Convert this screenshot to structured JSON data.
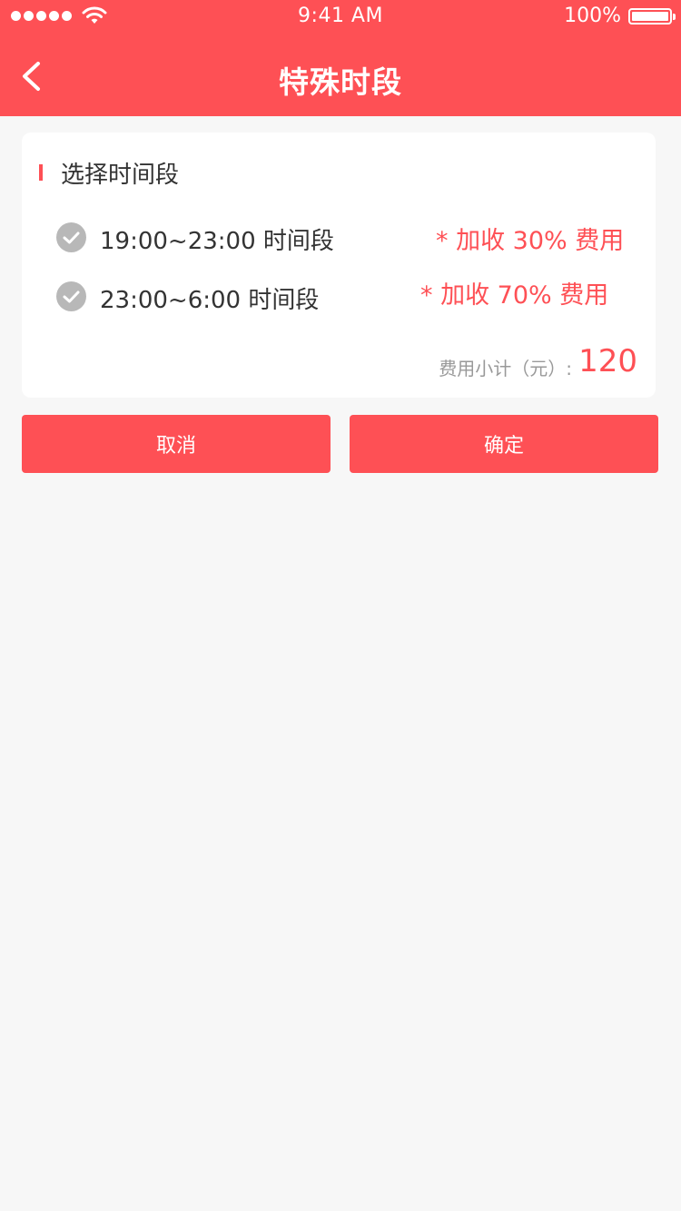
{
  "status_bar": {
    "time": "9:41 AM",
    "battery": "100%"
  },
  "nav": {
    "title": "特殊时段"
  },
  "section": {
    "title": "选择时间段"
  },
  "options": [
    {
      "label": "19:00~23:00 时间段",
      "surcharge": "* 加收 30% 费用",
      "checked": true
    },
    {
      "label": "23:00~6:00 时间段",
      "surcharge": "* 加收 70% 费用",
      "checked": true
    }
  ],
  "subtotal": {
    "label": "费用小计（元）:",
    "value": "120"
  },
  "buttons": {
    "cancel": "取消",
    "confirm": "确定"
  },
  "colors": {
    "brand": "#fe5055",
    "background": "#f7f7f7",
    "check": "#b8b8b8"
  }
}
